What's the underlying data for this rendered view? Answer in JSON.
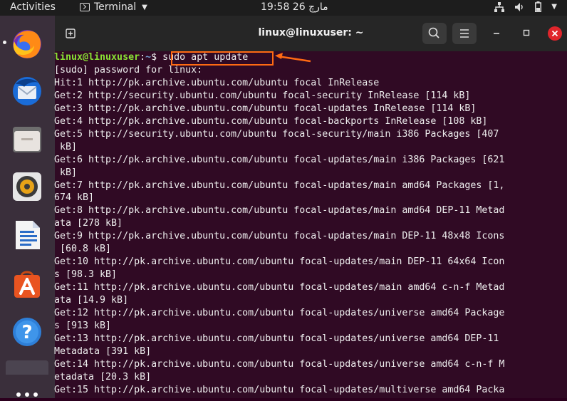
{
  "topbar": {
    "activities": "Activities",
    "app_menu": "Terminal",
    "clock": "19:58  26 مارچ"
  },
  "dock": {
    "apps": [
      {
        "name": "Firefox"
      },
      {
        "name": "Thunderbird"
      },
      {
        "name": "Files"
      },
      {
        "name": "Rhythmbox"
      },
      {
        "name": "LibreOffice Writer"
      },
      {
        "name": "Ubuntu Software"
      },
      {
        "name": "Help"
      },
      {
        "name": "Terminal"
      }
    ]
  },
  "window": {
    "title": "linux@linuxuser: ~"
  },
  "terminal": {
    "prompt_user": "linux@linuxuser",
    "prompt_path": "~",
    "prompt_symbol": "$",
    "command": "sudo apt update",
    "lines": [
      "[sudo] password for linux:",
      "Hit:1 http://pk.archive.ubuntu.com/ubuntu focal InRelease",
      "Get:2 http://security.ubuntu.com/ubuntu focal-security InRelease [114 kB]",
      "Get:3 http://pk.archive.ubuntu.com/ubuntu focal-updates InRelease [114 kB]",
      "Get:4 http://pk.archive.ubuntu.com/ubuntu focal-backports InRelease [108 kB]",
      "Get:5 http://security.ubuntu.com/ubuntu focal-security/main i386 Packages [407",
      " kB]",
      "Get:6 http://pk.archive.ubuntu.com/ubuntu focal-updates/main i386 Packages [621",
      " kB]",
      "Get:7 http://pk.archive.ubuntu.com/ubuntu focal-updates/main amd64 Packages [1,",
      "674 kB]",
      "Get:8 http://pk.archive.ubuntu.com/ubuntu focal-updates/main amd64 DEP-11 Metad",
      "ata [278 kB]",
      "Get:9 http://pk.archive.ubuntu.com/ubuntu focal-updates/main DEP-11 48x48 Icons",
      " [60.8 kB]",
      "Get:10 http://pk.archive.ubuntu.com/ubuntu focal-updates/main DEP-11 64x64 Icon",
      "s [98.3 kB]",
      "Get:11 http://pk.archive.ubuntu.com/ubuntu focal-updates/main amd64 c-n-f Metad",
      "ata [14.9 kB]",
      "Get:12 http://pk.archive.ubuntu.com/ubuntu focal-updates/universe amd64 Package",
      "s [913 kB]",
      "Get:13 http://pk.archive.ubuntu.com/ubuntu focal-updates/universe amd64 DEP-11",
      "Metadata [391 kB]",
      "Get:14 http://pk.archive.ubuntu.com/ubuntu focal-updates/universe amd64 c-n-f M",
      "etadata [20.3 kB]",
      "Get:15 http://pk.archive.ubuntu.com/ubuntu focal-updates/multiverse amd64 Packa"
    ]
  },
  "colors": {
    "terminal_bg": "#300a24",
    "prompt_user": "#8ae234",
    "prompt_path": "#729fcf",
    "highlight": "#ff6a13"
  }
}
